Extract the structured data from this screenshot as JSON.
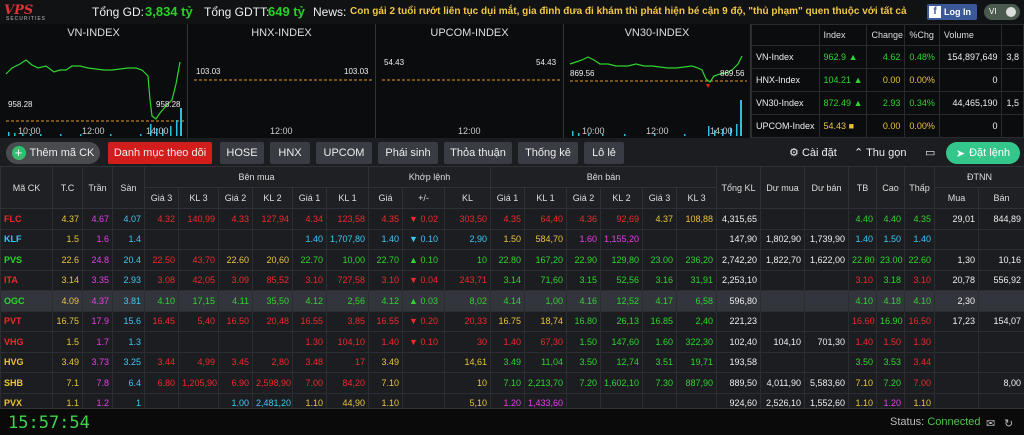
{
  "header": {
    "logo": "VPS",
    "logo_sub": "SECURITIES",
    "total_gd_label": "Tổng GD:",
    "total_gd_value": "3,834 tỷ",
    "total_gdtt_label": "Tổng GDTT:",
    "total_gdtt_value": "649 tỷ",
    "news_label": "News:",
    "news_text": "Con gái 2 tuổi rướt liên tục dụi mắt, gia đình đưa đi khám thì phát hiện bé cận 9 độ, \"thủ phạm\" quen thuộc với tất cả",
    "login_label": "Log In",
    "lang_label": "VI"
  },
  "charts": [
    {
      "title": "VN-INDEX",
      "ref": "958.28",
      "ref2": "958.28",
      "ticks": [
        "10:00",
        "12:00",
        "14:00"
      ]
    },
    {
      "title": "HNX-INDEX",
      "ref": "103.03",
      "ref2": "103.03",
      "ticks": [
        "12:00"
      ]
    },
    {
      "title": "UPCOM-INDEX",
      "ref": "54.43",
      "ref2": "54.43",
      "ticks": [
        "12:00"
      ]
    },
    {
      "title": "VN30-INDEX",
      "ref": "869.56",
      "ref2": "869.56",
      "ticks": [
        "10:00",
        "12:00",
        "14:00"
      ]
    }
  ],
  "index_table": {
    "headers": [
      "",
      "Index",
      "Change",
      "%Chg",
      "Volume",
      ""
    ],
    "rows": [
      {
        "name": "VN-Index",
        "index": "962.9",
        "arrow": "▲",
        "change": "4.62",
        "pct": "0.48%",
        "volume": "154,897,649",
        "extra": "3,8"
      },
      {
        "name": "HNX-Index",
        "index": "104.21",
        "arrow": "▲",
        "change": "0.00",
        "pct": "0.00%",
        "volume": "0",
        "extra": ""
      },
      {
        "name": "VN30-Index",
        "index": "872.49",
        "arrow": "▲",
        "change": "2.93",
        "pct": "0.34%",
        "volume": "44,465,190",
        "extra": "1,5"
      },
      {
        "name": "UPCOM-Index",
        "index": "54.43",
        "arrow": "■",
        "change": "0.00",
        "pct": "0.00%",
        "volume": "0",
        "extra": ""
      }
    ]
  },
  "tabs": {
    "add": "Thêm mã CK",
    "items": [
      "Danh mục theo dõi",
      "HOSE",
      "HNX",
      "UPCOM",
      "Phái sinh",
      "Thỏa thuận",
      "Thống kê",
      "Lô lẻ"
    ],
    "settings": "Cài đặt",
    "collapse": "Thu gọn",
    "order": "Đặt lệnh"
  },
  "grid": {
    "group_headers": [
      "Bên mua",
      "Khớp lệnh",
      "Bên bán",
      "ĐTNN"
    ],
    "headers": [
      "Mã CK",
      "T.C",
      "Trần",
      "Sàn",
      "Giá 3",
      "KL 3",
      "Giá 2",
      "KL 2",
      "Giá 1",
      "KL 1",
      "Giá",
      "+/-",
      "KL",
      "Giá 1",
      "KL 1",
      "Giá 2",
      "KL 2",
      "Giá 3",
      "KL 3",
      "Tổng KL",
      "Dư mua",
      "Dư bán",
      "TB",
      "Cao",
      "Thấp",
      "Mua",
      "Bán"
    ],
    "rows": [
      {
        "sym": "FLC",
        "c": [
          "r",
          "y",
          "m",
          "c",
          "r",
          "r",
          "r",
          "r",
          "r",
          "r",
          "r",
          "r",
          "r",
          "r",
          "r",
          "r",
          "r",
          "y",
          "y",
          "w",
          "w",
          "w",
          "g",
          "g",
          "g",
          "w",
          "w"
        ],
        "v": [
          "FLC",
          "4.37",
          "4.67",
          "4.07",
          "4.32",
          "140,99",
          "4.33",
          "127,94",
          "4.34",
          "123,58",
          "4.35",
          "▼ 0.02",
          "303,50",
          "4.35",
          "64,40",
          "4.36",
          "92,69",
          "4.37",
          "108,88",
          "4,315,65",
          "",
          "",
          "4.40",
          "4.40",
          "4.35",
          "29,01",
          "844,89"
        ]
      },
      {
        "sym": "KLF",
        "c": [
          "c",
          "y",
          "m",
          "c",
          "w",
          "w",
          "w",
          "w",
          "c",
          "c",
          "c",
          "c",
          "c",
          "y",
          "y",
          "m",
          "m",
          "w",
          "w",
          "w",
          "w",
          "w",
          "c",
          "c",
          "c",
          "w",
          "w"
        ],
        "v": [
          "KLF",
          "1.5",
          "1.6",
          "1.4",
          "",
          "",
          "",
          "",
          "1.40",
          "1,707,80",
          "1.40",
          "▼ 0.10",
          "2,90",
          "1.50",
          "584,70",
          "1.60",
          "1,155,20",
          "",
          "",
          "147,90",
          "1,802,90",
          "1,739,90",
          "1.40",
          "1.50",
          "1.40",
          "",
          ""
        ]
      },
      {
        "sym": "PVS",
        "c": [
          "g",
          "y",
          "m",
          "c",
          "r",
          "r",
          "y",
          "y",
          "g",
          "g",
          "g",
          "g",
          "g",
          "g",
          "g",
          "g",
          "g",
          "g",
          "g",
          "w",
          "w",
          "w",
          "g",
          "g",
          "g",
          "w",
          "w"
        ],
        "v": [
          "PVS",
          "22.6",
          "24.8",
          "20.4",
          "22.50",
          "43,70",
          "22.60",
          "20,60",
          "22.70",
          "10,00",
          "22.70",
          "▲ 0.10",
          "10",
          "22.80",
          "167,20",
          "22.90",
          "129,80",
          "23.00",
          "236,20",
          "2,742,20",
          "1,822,70",
          "1,622,00",
          "22.80",
          "23.00",
          "22.60",
          "1,30",
          "10,16"
        ]
      },
      {
        "sym": "ITA",
        "c": [
          "r",
          "y",
          "m",
          "c",
          "r",
          "r",
          "r",
          "r",
          "r",
          "r",
          "r",
          "r",
          "r",
          "g",
          "g",
          "g",
          "g",
          "g",
          "g",
          "w",
          "w",
          "w",
          "r",
          "g",
          "r",
          "w",
          "w"
        ],
        "v": [
          "ITA",
          "3.14",
          "3.35",
          "2.93",
          "3.08",
          "42,05",
          "3.09",
          "85,52",
          "3.10",
          "727,58",
          "3.10",
          "▼ 0.04",
          "243,71",
          "3.14",
          "71,60",
          "3.15",
          "52,56",
          "3.16",
          "31,91",
          "2,253,10",
          "",
          "",
          "3.10",
          "3.18",
          "3.10",
          "20,78",
          "556,92"
        ]
      },
      {
        "sym": "OGC",
        "c": [
          "g",
          "y",
          "m",
          "c",
          "g",
          "g",
          "g",
          "g",
          "g",
          "g",
          "g",
          "g",
          "g",
          "g",
          "g",
          "g",
          "g",
          "g",
          "g",
          "w",
          "w",
          "w",
          "g",
          "g",
          "g",
          "w",
          "w"
        ],
        "v": [
          "OGC",
          "4.09",
          "4.37",
          "3.81",
          "4.10",
          "17,15",
          "4.11",
          "35,50",
          "4.12",
          "2,56",
          "4.12",
          "▲ 0.03",
          "8,02",
          "4.14",
          "1,00",
          "4.16",
          "12,52",
          "4.17",
          "6,58",
          "596,80",
          "",
          "",
          "4.10",
          "4.18",
          "4.10",
          "2,30",
          ""
        ]
      },
      {
        "sym": "PVT",
        "c": [
          "r",
          "y",
          "m",
          "c",
          "r",
          "r",
          "r",
          "r",
          "r",
          "r",
          "r",
          "r",
          "r",
          "y",
          "y",
          "g",
          "g",
          "g",
          "g",
          "w",
          "w",
          "w",
          "r",
          "g",
          "r",
          "w",
          "w"
        ],
        "v": [
          "PVT",
          "16.75",
          "17.9",
          "15.6",
          "16.45",
          "5,40",
          "16.50",
          "20,48",
          "16.55",
          "3,85",
          "16.55",
          "▼ 0.20",
          "20,33",
          "16.75",
          "18,74",
          "16.80",
          "26,13",
          "16.85",
          "2,40",
          "221,23",
          "",
          "",
          "16.60",
          "16.90",
          "16.50",
          "17,23",
          "154,07"
        ]
      },
      {
        "sym": "VHG",
        "c": [
          "r",
          "y",
          "m",
          "c",
          "w",
          "w",
          "w",
          "w",
          "r",
          "r",
          "r",
          "r",
          "r",
          "r",
          "r",
          "g",
          "g",
          "g",
          "g",
          "w",
          "w",
          "w",
          "r",
          "r",
          "r",
          "w",
          "w"
        ],
        "v": [
          "VHG",
          "1.5",
          "1.7",
          "1.3",
          "",
          "",
          "",
          "",
          "1.30",
          "104,10",
          "1.40",
          "▼ 0.10",
          "30",
          "1.40",
          "67,30",
          "1.50",
          "147,60",
          "1.60",
          "322,30",
          "102,40",
          "104,10",
          "701,30",
          "1.40",
          "1.50",
          "1.30",
          "",
          ""
        ]
      },
      {
        "sym": "HVG",
        "c": [
          "y",
          "y",
          "m",
          "c",
          "r",
          "r",
          "r",
          "r",
          "r",
          "r",
          "y",
          "w",
          "y",
          "g",
          "g",
          "g",
          "g",
          "g",
          "g",
          "w",
          "w",
          "w",
          "g",
          "g",
          "r",
          "w",
          "w"
        ],
        "v": [
          "HVG",
          "3.49",
          "3.73",
          "3.25",
          "3.44",
          "4,99",
          "3.45",
          "2,80",
          "3.48",
          "17",
          "3.49",
          "",
          "14,61",
          "3.49",
          "11,04",
          "3.50",
          "12,74",
          "3.51",
          "19,71",
          "193,58",
          "",
          "",
          "3.50",
          "3.53",
          "3.44",
          "",
          ""
        ]
      },
      {
        "sym": "SHB",
        "c": [
          "y",
          "y",
          "m",
          "c",
          "r",
          "r",
          "r",
          "r",
          "r",
          "r",
          "y",
          "w",
          "y",
          "g",
          "g",
          "g",
          "g",
          "g",
          "g",
          "w",
          "w",
          "w",
          "y",
          "g",
          "r",
          "w",
          "w"
        ],
        "v": [
          "SHB",
          "7.1",
          "7.8",
          "6.4",
          "6.80",
          "1,205,90",
          "6.90",
          "2,598,90",
          "7.00",
          "84,20",
          "7.10",
          "",
          "10",
          "7.10",
          "2,213,70",
          "7.20",
          "1,602,10",
          "7.30",
          "887,90",
          "889,50",
          "4,011,90",
          "5,583,60",
          "7.10",
          "7.20",
          "7.00",
          "",
          "8,00"
        ]
      },
      {
        "sym": "PVX",
        "c": [
          "y",
          "y",
          "m",
          "c",
          "w",
          "w",
          "c",
          "c",
          "y",
          "y",
          "y",
          "w",
          "y",
          "m",
          "m",
          "w",
          "w",
          "w",
          "w",
          "w",
          "w",
          "w",
          "y",
          "m",
          "y",
          "w",
          "w"
        ],
        "v": [
          "PVX",
          "1.1",
          "1.2",
          "1",
          "",
          "",
          "1.00",
          "2,481,20",
          "1.10",
          "44,90",
          "1.10",
          "",
          "5,10",
          "1.20",
          "1,433,60",
          "",
          "",
          "",
          "",
          "924,60",
          "2,526,10",
          "1,552,60",
          "1.10",
          "1.20",
          "1.10",
          "",
          ""
        ]
      }
    ]
  },
  "status": {
    "clock": "15:57:54",
    "label": "Status:",
    "value": "Connected"
  }
}
